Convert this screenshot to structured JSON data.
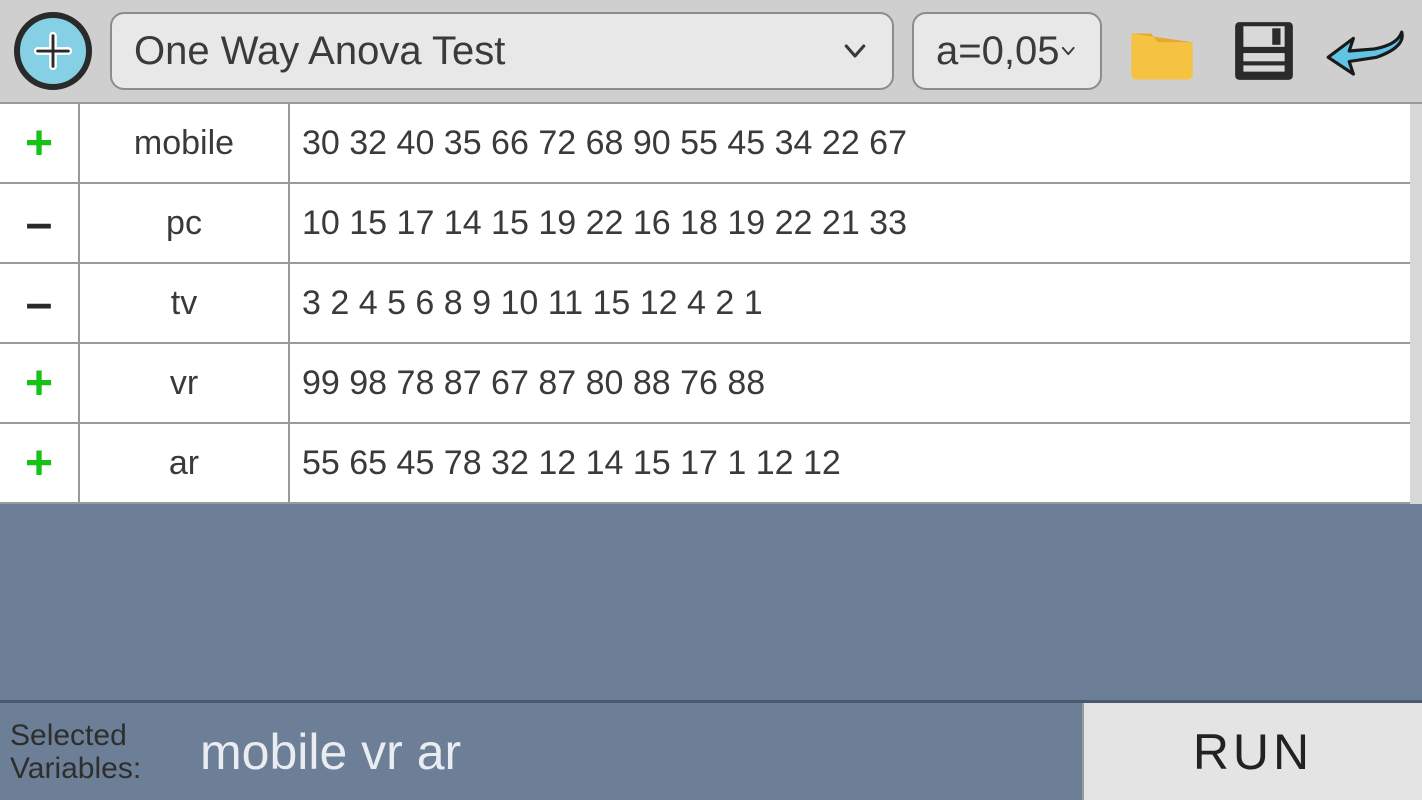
{
  "toolbar": {
    "test_label": "One Way Anova Test",
    "alpha_label": "a=0,05"
  },
  "rows": [
    {
      "selected": true,
      "name": "mobile",
      "values": "30 32 40 35 66 72 68 90 55 45 34 22 67"
    },
    {
      "selected": false,
      "name": "pc",
      "values": "10 15 17 14 15 19 22 16 18 19 22 21 33"
    },
    {
      "selected": false,
      "name": "tv",
      "values": "3 2 4 5 6 8 9 10 11 15 12 4 2 1"
    },
    {
      "selected": true,
      "name": "vr",
      "values": "99 98 78 87 67 87 80 88 76 88"
    },
    {
      "selected": true,
      "name": "ar",
      "values": "55 65 45 78 32 12 14 15 17 1 12 12"
    }
  ],
  "bottom": {
    "label_line1": "Selected",
    "label_line2": "Variables:",
    "selected_vars": "mobile vr ar",
    "run_label": "RUN"
  },
  "icons": {
    "plus": "+",
    "minus": "–"
  }
}
